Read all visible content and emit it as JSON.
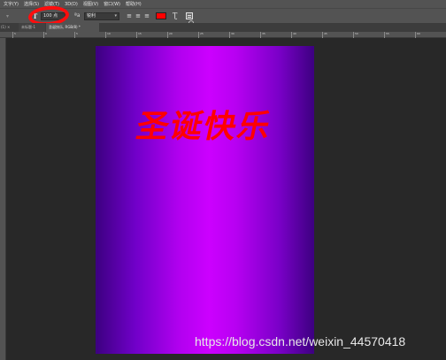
{
  "menubar": {
    "items": [
      "文字(Y)",
      "选择(S)",
      "滤镜(T)",
      "3D(D)",
      "视图(V)",
      "窗口(W)",
      "帮助(H)"
    ]
  },
  "options": {
    "font_size": "100 点",
    "aa_icon": "ªa",
    "aa_mode": "锐利",
    "text_color": "#ff0000",
    "icons": [
      "type-tool-icon",
      "align-left-icon",
      "align-center-icon",
      "align-right-icon",
      "warp-text-icon",
      "character-panel-icon"
    ]
  },
  "tabs": {
    "left_stub": "(1) ×",
    "items": [
      "未标题-1",
      "圣诞快乐, RGB/8) *"
    ]
  },
  "ruler": {
    "labels": [
      "5",
      "0",
      "5",
      "10",
      "15",
      "20",
      "25",
      "30",
      "35",
      "40",
      "45",
      "50",
      "55",
      "60",
      "65",
      "70",
      "75"
    ]
  },
  "canvas": {
    "text": "圣诞快乐",
    "text_color": "#ff0000",
    "gradient_colors": [
      "#3c0080",
      "#cc00ff",
      "#3c0080"
    ]
  },
  "watermark": "https://blog.csdn.net/weixin_44570418",
  "annotation": {
    "color": "#ff0d0d"
  }
}
